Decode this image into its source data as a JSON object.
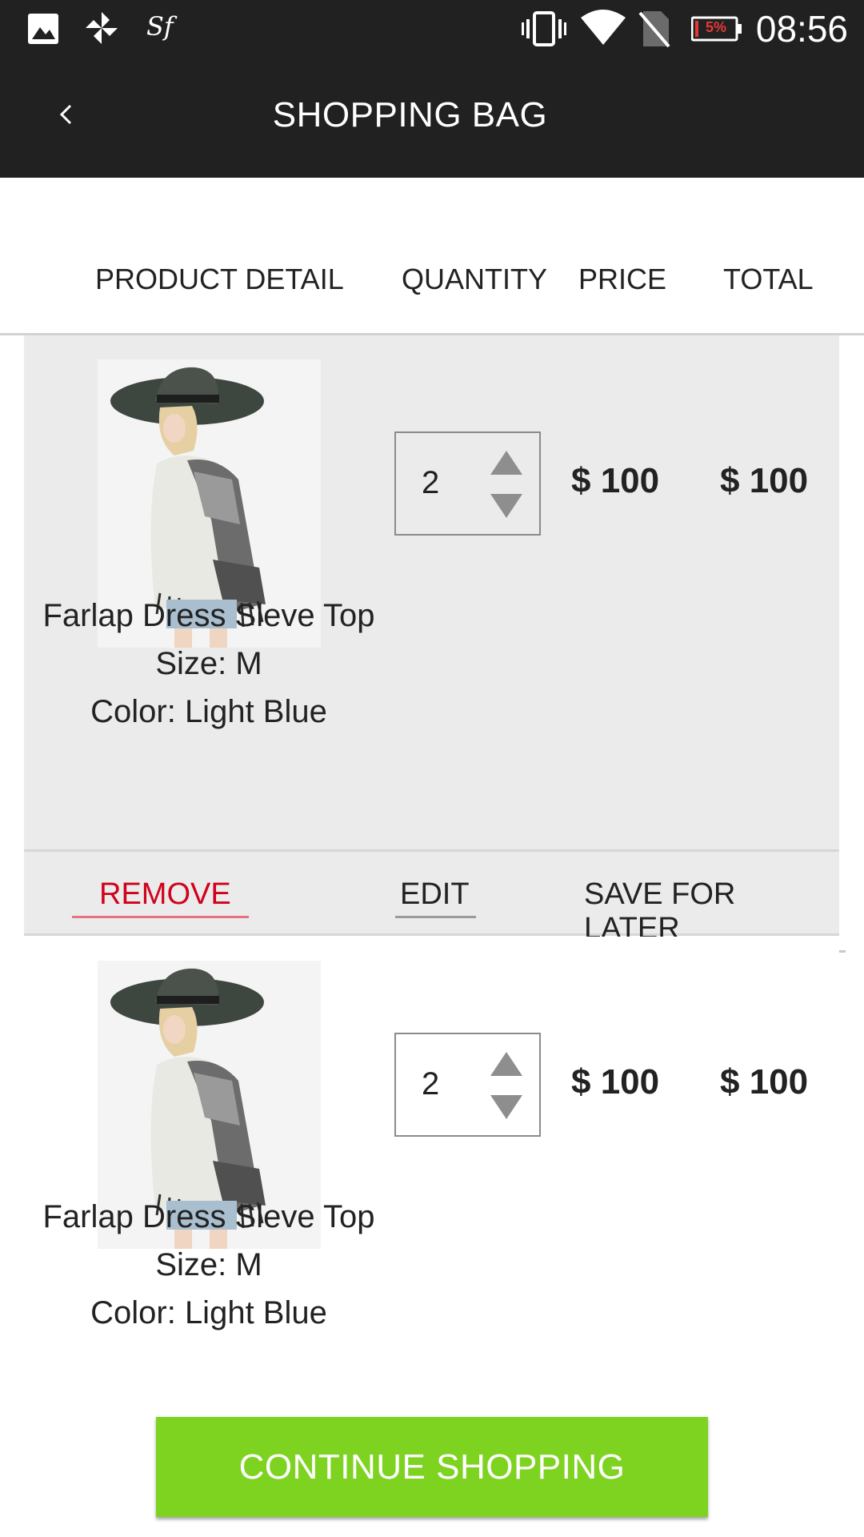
{
  "status_bar": {
    "time": "08:56",
    "battery_label": "5%",
    "icons": [
      "image-icon",
      "pinwheel-icon",
      "sf-icon",
      "vibrate-icon",
      "wifi-icon",
      "no-sim-icon",
      "battery-icon"
    ],
    "sf_label": "Sf"
  },
  "app_bar": {
    "title": "SHOPPING BAG",
    "back_icon": "chevron-left-icon"
  },
  "columns": {
    "product_detail": "PRODUCT DETAIL",
    "quantity": "QUANTITY",
    "price": "PRICE",
    "total": "TOTAL"
  },
  "items": [
    {
      "name": "Farlap Dress Sleve Top",
      "size": "Size: M",
      "color": "Color: Light Blue",
      "quantity": "2",
      "price": "$ 100",
      "total": "$ 100"
    },
    {
      "name": "Farlap Dress Sleve Top",
      "size": "Size: M",
      "color": "Color: Light Blue",
      "quantity": "2",
      "price": "$ 100",
      "total": "$ 100"
    }
  ],
  "actions": {
    "remove": "REMOVE",
    "edit": "EDIT",
    "save_for_later": "SAVE FOR LATER"
  },
  "continue_button": "CONTINUE SHOPPING",
  "colors": {
    "bar": "#212121",
    "accent_green": "#7ed321",
    "remove_red": "#d0021b",
    "card_gray": "#ebebeb"
  }
}
